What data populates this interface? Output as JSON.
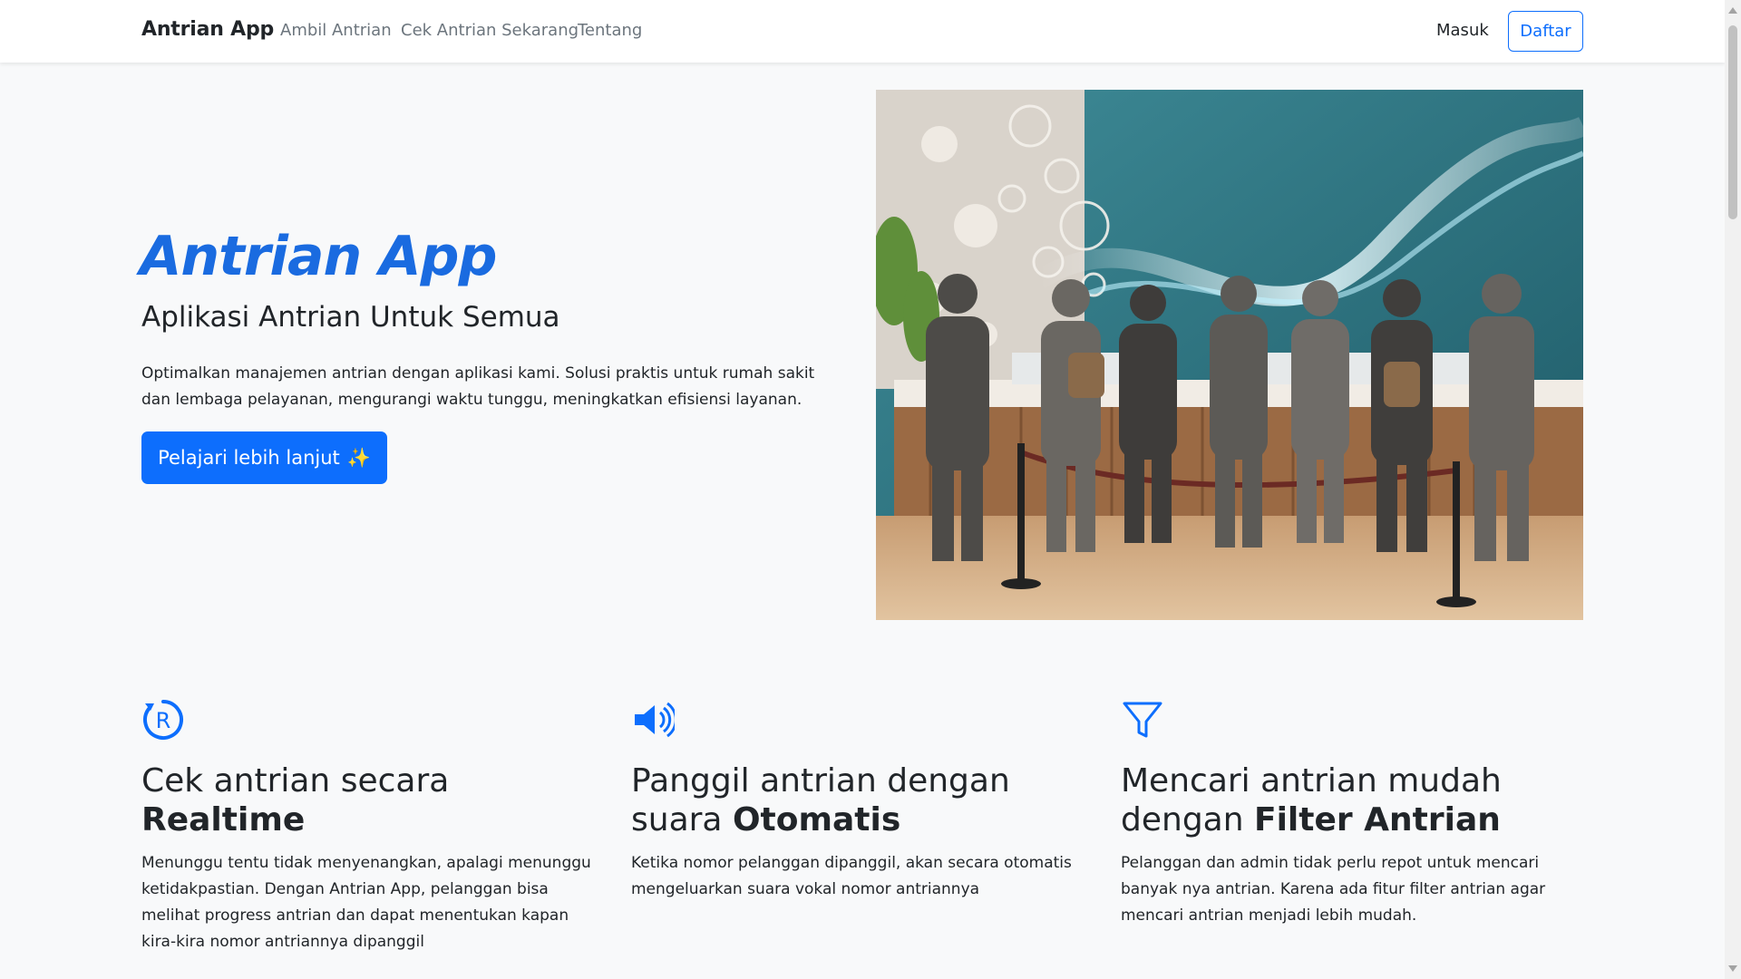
{
  "navbar": {
    "brand": "Antrian App",
    "links": [
      "Ambil Antrian",
      "Cek Antrian Sekarang",
      "Tentang"
    ],
    "login": "Masuk",
    "register": "Daftar"
  },
  "hero": {
    "title": "Antrian App",
    "subtitle": "Aplikasi Antrian Untuk Semua",
    "description": "Optimalkan manajemen antrian dengan aplikasi kami. Solusi praktis untuk rumah sakit dan lembaga pelayanan, mengurangi waktu tunggu, meningkatkan efisiensi layanan.",
    "button": "Pelajari lebih lanjut",
    "button_emoji": "✨"
  },
  "features": [
    {
      "icon": "realtime-icon",
      "title_plain": "Cek antrian secara ",
      "title_bold": "Realtime",
      "text": "Menunggu tentu tidak menyenangkan, apalagi menunggu ketidakpastian. Dengan Antrian App, pelanggan bisa melihat progress antrian dan dapat menentukan kapan kira-kira nomor antriannya dipanggil"
    },
    {
      "icon": "speaker-icon",
      "title_plain": "Panggil antrian dengan suara ",
      "title_bold": "Otomatis",
      "text": "Ketika nomor pelanggan dipanggil, akan secara otomatis mengeluarkan suara vokal nomor antriannya"
    },
    {
      "icon": "filter-icon",
      "title_plain": "Mencari antrian mudah dengan ",
      "title_bold": "Filter Antrian",
      "text": "Pelanggan dan admin tidak perlu repot untuk mencari banyak nya antrian. Karena ada fitur filter antrian agar mencari antrian menjadi lebih mudah."
    }
  ],
  "colors": {
    "primary": "#0d6efd",
    "hero_title": "#1a6be0",
    "background": "#f8f9fa"
  }
}
